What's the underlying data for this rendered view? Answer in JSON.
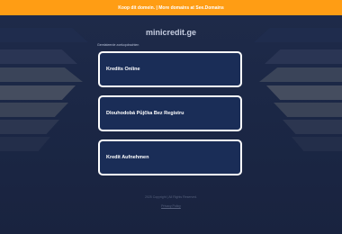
{
  "topbar": {
    "text": "Koop dit domein. | More domains at See.Domains"
  },
  "header": {
    "domain": "minicredit.ge",
    "related_label": "Gerelateerde zoekopdrachten"
  },
  "results": [
    {
      "label": "Kredits Online"
    },
    {
      "label": "Dlouhodobá Půjčka Bez Registru"
    },
    {
      "label": "Kredit Aufnehmen"
    }
  ],
  "footer": {
    "copyright": "2025 Copyright | All Rights Reserved.",
    "privacy": "Privacy Policy"
  },
  "colors": {
    "topbar": "#ff9d14",
    "background": "#1a2644",
    "card": "#1a2d57",
    "card_border": "#ffffff"
  }
}
